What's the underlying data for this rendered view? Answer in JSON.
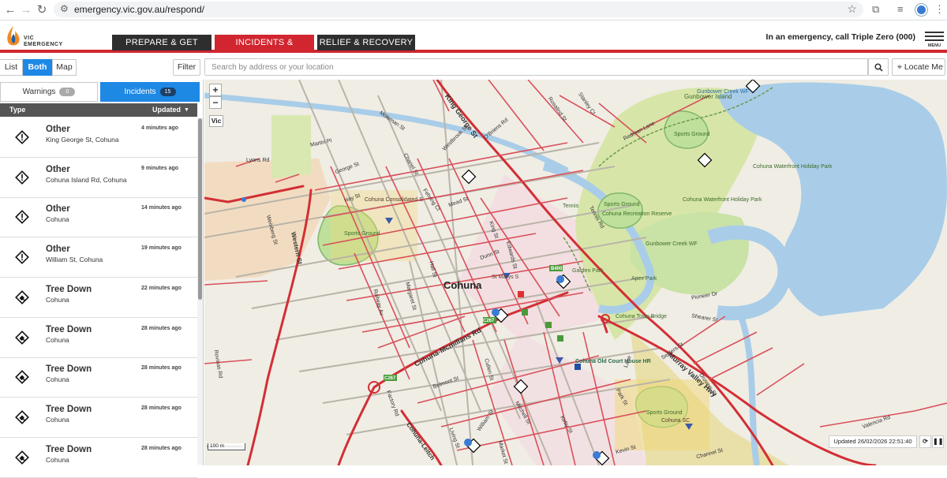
{
  "browser": {
    "url": "emergency.vic.gov.au/respond/",
    "nav_icons": [
      "back-icon",
      "forward-icon",
      "reload-icon"
    ]
  },
  "header": {
    "logo_line1": "VIC",
    "logo_line2": "EMERGENCY",
    "tabs": [
      "PREPARE & GET READY",
      "INCIDENTS & WARNINGS",
      "RELIEF & RECOVERY"
    ],
    "active_tab": "INCIDENTS & WARNINGS",
    "emergency_text": "In an emergency, call Triple Zero (000)",
    "menu_label": "MENU",
    "colors": {
      "brand_red": "#d12630",
      "dark_tab": "#2e2e2e",
      "accent_blue": "#1e88e5"
    }
  },
  "toolbar": {
    "view_modes": [
      "List",
      "Both",
      "Map"
    ],
    "selected_view": "Both",
    "filter_label": "Filter",
    "search_placeholder": "Search by address or your location",
    "locate_label": "Locate Me"
  },
  "panel": {
    "warnings_label": "Warnings",
    "warnings_count": "0",
    "incidents_label": "Incidents",
    "incidents_count": "15",
    "col_type": "Type",
    "col_updated": "Updated",
    "items": [
      {
        "title": "Other",
        "location": "King George St, Cohuna",
        "time": "4 minutes ago",
        "icon": "other-incident-icon"
      },
      {
        "title": "Other",
        "location": "Cohuna Island Rd, Cohuna",
        "time": "9 minutes ago",
        "icon": "other-incident-icon"
      },
      {
        "title": "Other",
        "location": "Cohuna",
        "time": "14 minutes ago",
        "icon": "other-incident-icon"
      },
      {
        "title": "Other",
        "location": "William St, Cohuna",
        "time": "19 minutes ago",
        "icon": "other-incident-icon"
      },
      {
        "title": "Tree Down",
        "location": "Cohuna",
        "time": "22 minutes ago",
        "icon": "tree-down-icon"
      },
      {
        "title": "Tree Down",
        "location": "Cohuna",
        "time": "28 minutes ago",
        "icon": "tree-down-icon"
      },
      {
        "title": "Tree Down",
        "location": "Cohuna",
        "time": "28 minutes ago",
        "icon": "tree-down-icon"
      },
      {
        "title": "Tree Down",
        "location": "Cohuna",
        "time": "28 minutes ago",
        "icon": "tree-down-icon"
      },
      {
        "title": "Tree Down",
        "location": "Cohuna",
        "time": "28 minutes ago",
        "icon": "tree-down-icon"
      }
    ]
  },
  "map": {
    "zoom_in": "+",
    "zoom_out": "−",
    "vic_label": "Vic",
    "scale_label": "100 m",
    "updated_text": "Updated 26/02/2026 22:51:40",
    "town_label": "Cohuna",
    "labels": {
      "gunbower_island": "Gunbower Island",
      "gunbower_creek_wf_1": "Gunbower Creek WF",
      "gunbower_creek_wf_2": "Gunbower Creek WF",
      "sports_ground_1": "Sports Ground",
      "sports_ground_2": "Sports Ground",
      "sports_ground_3": "Sports Ground",
      "sports_ground_4": "Sports Ground",
      "tennis": "Tennis",
      "rec_reserve": "Cohuna Recreation Reserve",
      "waterfront_1": "Cohuna Waterfront Holiday Park",
      "waterfront_2": "Cohuna Waterfront Holiday Park",
      "garden_park": "Garden Park",
      "apex_park": "Apex Park",
      "town_bridge": "Cohuna Town Bridge",
      "consolidated_s": "Cohuna Consolidated S",
      "st_marys": "St Marys S",
      "old_court_house": "Cohuna Old Court House HR",
      "cohuna_sc": "Cohuna SC",
      "king_george_st": "King George St",
      "murray_valley_hwy": "Murray Valley Hwy",
      "cohuna_mcmillans_rd": "Cohuna-Mcmillans Rd",
      "western_st": "Western St",
      "cohuna_leitchville": "Cohuna-Leitch",
      "lyons_rd": "Lyons Rd",
      "martin_pl": "Martin Pl",
      "george_st": "George St",
      "hay_st": "Hay St",
      "mead_st": "Mead St",
      "dunn_st": "Dunn St",
      "railway_av": "Railway Av",
      "hall_st": "Hall St",
      "margaret_st": "Margaret St",
      "weinberg_st": "Weinberg St",
      "moleman_st": "Moleman St",
      "westbrook_st": "Westbrook St",
      "obriens_rd": "O'Briens Rd",
      "rosalind_st": "Rosalind St",
      "stanley_ct": "Stanley Ct",
      "redman_lane": "Redman Lane",
      "tennis_rd": "Tennis Rd",
      "pioneer_dr": "Pioneer Dr",
      "shearer_st": "Shearer St",
      "settlers_st": "Settlers St",
      "drovers_st": "Drovers St",
      "valencia_rd": "Valencia Rd",
      "kirby_st": "Kirby St",
      "mitchell_st": "Mitchell St",
      "william_st": "William St",
      "market_st": "Market St",
      "factory_rd": "Factory Rd",
      "rovinas_rd": "Rovinas Rd",
      "belmont_st": "Belmont St",
      "cullen_st": "Cullen St",
      "park_st": "Park St",
      "lane": "Lane",
      "channel_st": "Channel St",
      "kevin_st": "Kevin St",
      "living_st": "Living St",
      "fehring_ct": "Fehring Ct",
      "chanel_st": "Chanel St",
      "edwards_st": "Edwards St",
      "king_st": "King St",
      "route_c267a": "C267",
      "route_c267b": "C267",
      "route_b400": "B400"
    }
  }
}
